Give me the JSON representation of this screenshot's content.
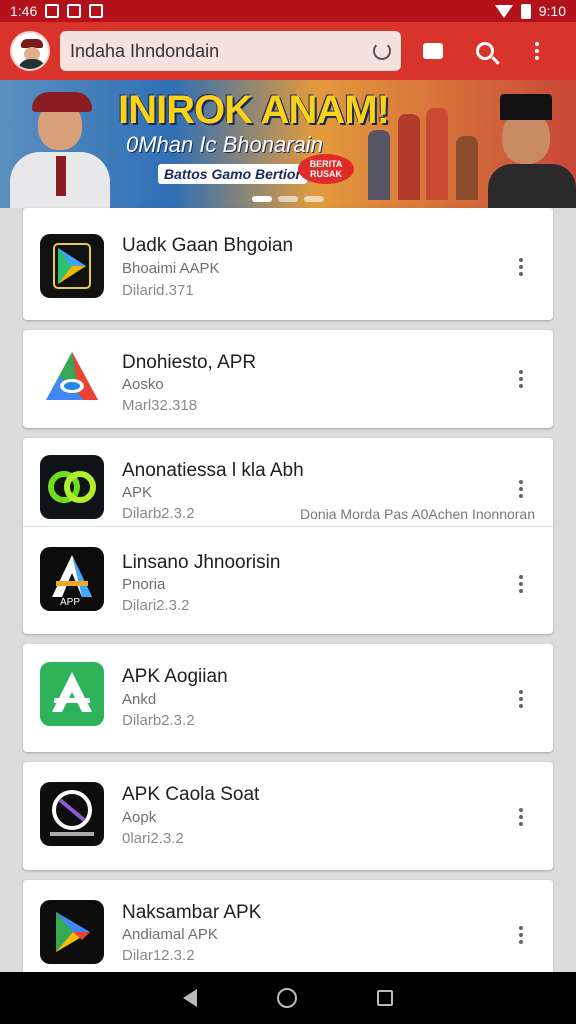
{
  "status_bar": {
    "time_left": "1:46",
    "time_right": "9:10"
  },
  "search": {
    "value": "Indaha Ihndondain"
  },
  "banner": {
    "headline": "INIROK ANAM!",
    "subtitle": "0Mhan Ic Bhonarain",
    "tagline": "Battos Gamo Bertior",
    "pill_text": "BERITA RUSAK"
  },
  "apps": [
    {
      "title": "Uadk Gaan Bhgoian",
      "subtitle": "Bhoaimi AAPK",
      "version": "Dilarid.371",
      "extra": ""
    },
    {
      "title": "Dnohiesto, APR",
      "subtitle": "Aosko",
      "version": "Marl32.318",
      "extra": ""
    },
    {
      "title": "Anonatiessa l kla Abh",
      "subtitle": "APK",
      "version": "Dilarb2.3.2",
      "extra": "Donia Morda Pas A0Achen Inonnoran"
    },
    {
      "title": "Linsano Jhnoorisin",
      "subtitle": "Pnoria",
      "version": "Dilari2.3.2",
      "extra": ""
    },
    {
      "title": "APK Aogiian",
      "subtitle": "Ankd",
      "version": "Dilarb2.3.2",
      "extra": ""
    },
    {
      "title": "APK Caola Soat",
      "subtitle": "Aopk",
      "version": "0lari2.3.2",
      "extra": ""
    },
    {
      "title": "Naksambar APK",
      "subtitle": "Andiamal APK",
      "version": "Dilar12.3.2",
      "extra": ""
    }
  ],
  "icons": {
    "app1": "play-store-icon",
    "app2": "drive-triangle-icon",
    "app3": "green-loop-icon",
    "app4": "app-a-icon",
    "app5": "app-store-a-icon",
    "app6": "circle-slash-icon",
    "app7": "play-triangle-icon"
  },
  "colors": {
    "status_bar": "#b3121b",
    "app_bar": "#d9342b",
    "accent_yellow": "#f9d21a"
  }
}
